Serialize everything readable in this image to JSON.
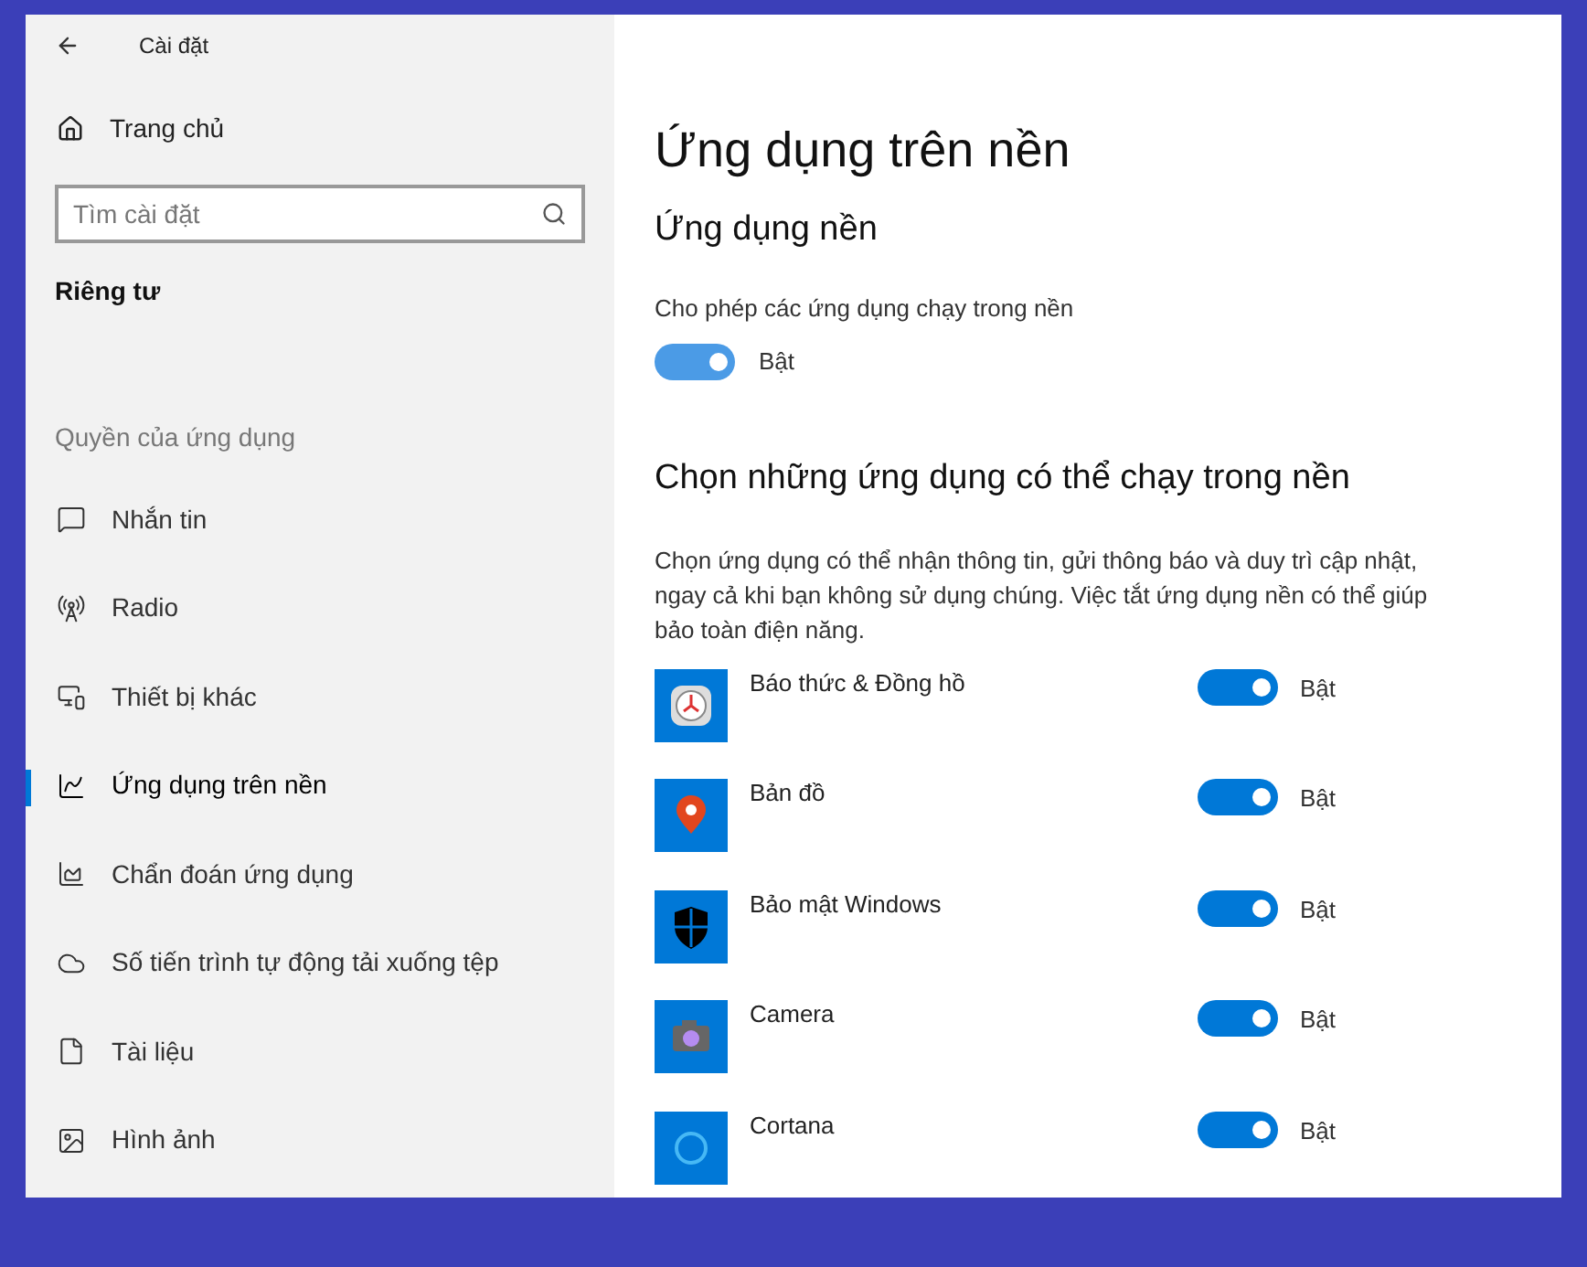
{
  "window": {
    "title": "Cài đặt"
  },
  "sidebar": {
    "home": "Trang chủ",
    "search": {
      "placeholder": "Tìm cài đặt"
    },
    "section": "Riêng tư",
    "group": "Quyền của ứng dụng",
    "items": [
      {
        "label": "Nhắn tin",
        "kind": "message",
        "selected": false
      },
      {
        "label": "Radio",
        "kind": "radio",
        "selected": false
      },
      {
        "label": "Thiết bị khác",
        "kind": "devices",
        "selected": false
      },
      {
        "label": "Ứng dụng trên nền",
        "kind": "background",
        "selected": true
      },
      {
        "label": "Chẩn đoán ứng dụng",
        "kind": "diagnostics",
        "selected": false
      },
      {
        "label": "Số tiến trình tự động tải xuống tệp",
        "kind": "cloud",
        "selected": false
      },
      {
        "label": "Tài liệu",
        "kind": "document",
        "selected": false
      },
      {
        "label": "Hình ảnh",
        "kind": "image",
        "selected": false
      }
    ]
  },
  "main": {
    "title": "Ứng dụng trên nền",
    "subtitle": "Ứng dụng nền",
    "allow": {
      "label": "Cho phép các ứng dụng chạy trong nền",
      "on": true,
      "state": "Bật"
    },
    "choose_title": "Chọn những ứng dụng có thể chạy trong nền",
    "description": "Chọn ứng dụng có thể nhận thông tin, gửi thông báo và duy trì cập nhật, ngay cả khi bạn không sử dụng chúng. Việc tắt ứng dụng nền có thể giúp bảo toàn điện năng.",
    "apps": [
      {
        "name": "Báo thức & Đồng hồ",
        "kind": "clock",
        "on": true,
        "state": "Bật"
      },
      {
        "name": "Bản đồ",
        "kind": "map",
        "on": true,
        "state": "Bật"
      },
      {
        "name": "Bảo mật Windows",
        "kind": "shield",
        "on": true,
        "state": "Bật"
      },
      {
        "name": "Camera",
        "kind": "camera",
        "on": true,
        "state": "Bật"
      },
      {
        "name": "Cortana",
        "kind": "ring",
        "on": true,
        "state": "Bật"
      }
    ]
  }
}
